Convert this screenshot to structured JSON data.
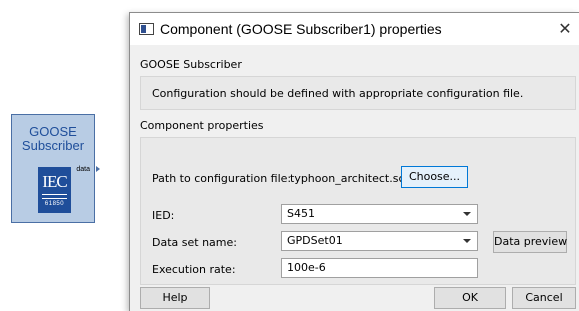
{
  "canvas_block": {
    "title_line1": "GOOSE",
    "title_line2": "Subscriber",
    "port_label": "data",
    "logo_text": "IEC",
    "logo_number": "61850"
  },
  "dialog": {
    "title": "Component (GOOSE Subscriber1) properties",
    "close_symbol": "✕",
    "section1_label": "GOOSE Subscriber",
    "info_text": "Configuration should be defined with appropriate configuration file.",
    "section2_label": "Component properties",
    "path": {
      "label": "Path to configuration file:",
      "value": "typhoon_architect.scd",
      "choose_button": "Choose..."
    },
    "ied": {
      "label": "IED:",
      "value": "S451"
    },
    "dataset": {
      "label": "Data set name:",
      "value": "GPDSet01",
      "preview_button": "Data preview"
    },
    "execution_rate": {
      "label": "Execution rate:",
      "value": "100e-6"
    },
    "buttons": {
      "help": "Help",
      "ok": "OK",
      "cancel": "Cancel"
    }
  }
}
